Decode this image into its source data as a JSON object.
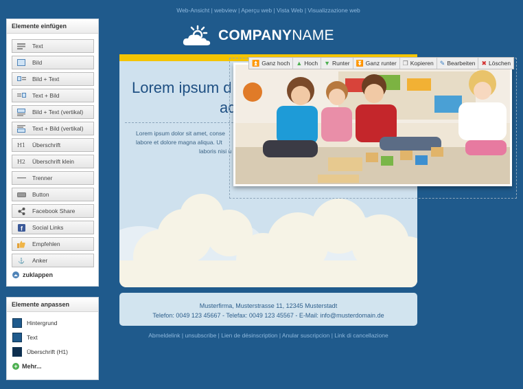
{
  "header": {
    "weblinks": "Web-Ansicht | webview | Aperçu web | Vista Web | Visualizzazione web",
    "logo_bold": "COMPANY",
    "logo_light": "NAME"
  },
  "insert_panel": {
    "title": "Elemente einfügen",
    "items": [
      {
        "label": "Text",
        "icon": "text-icon"
      },
      {
        "label": "Bild",
        "icon": "image-icon"
      },
      {
        "label": "Bild + Text",
        "icon": "image-text-icon"
      },
      {
        "label": "Text + Bild",
        "icon": "text-image-icon"
      },
      {
        "label": "Bild + Text (vertikal)",
        "icon": "image-text-vertical-icon"
      },
      {
        "label": "Text + Bild (vertikal)",
        "icon": "text-image-vertical-icon"
      },
      {
        "label": "Überschrift",
        "icon": "h1-icon"
      },
      {
        "label": "Überschrift klein",
        "icon": "h2-icon"
      },
      {
        "label": "Trenner",
        "icon": "divider-icon"
      },
      {
        "label": "Button",
        "icon": "button-icon"
      },
      {
        "label": "Facebook Share",
        "icon": "share-icon"
      },
      {
        "label": "Social Links",
        "icon": "facebook-icon"
      },
      {
        "label": "Empfehlen",
        "icon": "thumbs-up-icon"
      },
      {
        "label": "Anker",
        "icon": "anchor-icon"
      }
    ],
    "collapse_label": "zuklappen"
  },
  "adjust_panel": {
    "title": "Elemente anpassen",
    "items": [
      {
        "label": "Hintergrund",
        "color": "#1f5a8c"
      },
      {
        "label": "Text",
        "color": "#1f5a8c"
      },
      {
        "label": "Überschrift (H1)",
        "color": "#0e2f4f"
      }
    ],
    "more_label": "Mehr..."
  },
  "content": {
    "headline_line1": "Lorem ipsum d",
    "headline_line2": "ad",
    "body_line1": "Lorem ipsum dolor sit amet, conse",
    "body_line2": "labore et dolore magna aliqua. Ut",
    "body_line3": "laboris nisi u"
  },
  "toolbar": {
    "buttons": [
      {
        "label": "Ganz hoch",
        "icon": "double-arrow-up-icon"
      },
      {
        "label": "Hoch",
        "icon": "arrow-up-icon"
      },
      {
        "label": "Runter",
        "icon": "arrow-down-icon"
      },
      {
        "label": "Ganz runter",
        "icon": "double-arrow-down-icon"
      },
      {
        "label": "Kopieren",
        "icon": "copy-icon"
      },
      {
        "label": "Bearbeiten",
        "icon": "pencil-icon"
      },
      {
        "label": "Löschen",
        "icon": "delete-icon"
      }
    ]
  },
  "footer": {
    "address": "Musterfirma, Musterstrasse 11, 12345 Musterstadt",
    "contact": "Telefon: 0049 123 45667 - Telefax: 0049 123 45567 - E-Mail: info@musterdomain.de",
    "unsubscribe": "Abmeldelink | unsubscribe | Lien de désinscription | Anular suscripcion | Link di cancellazione"
  },
  "colors": {
    "page_bg": "#1f5a8c",
    "accent_yellow": "#f4c400",
    "card_bg": "#cfe1ee"
  }
}
